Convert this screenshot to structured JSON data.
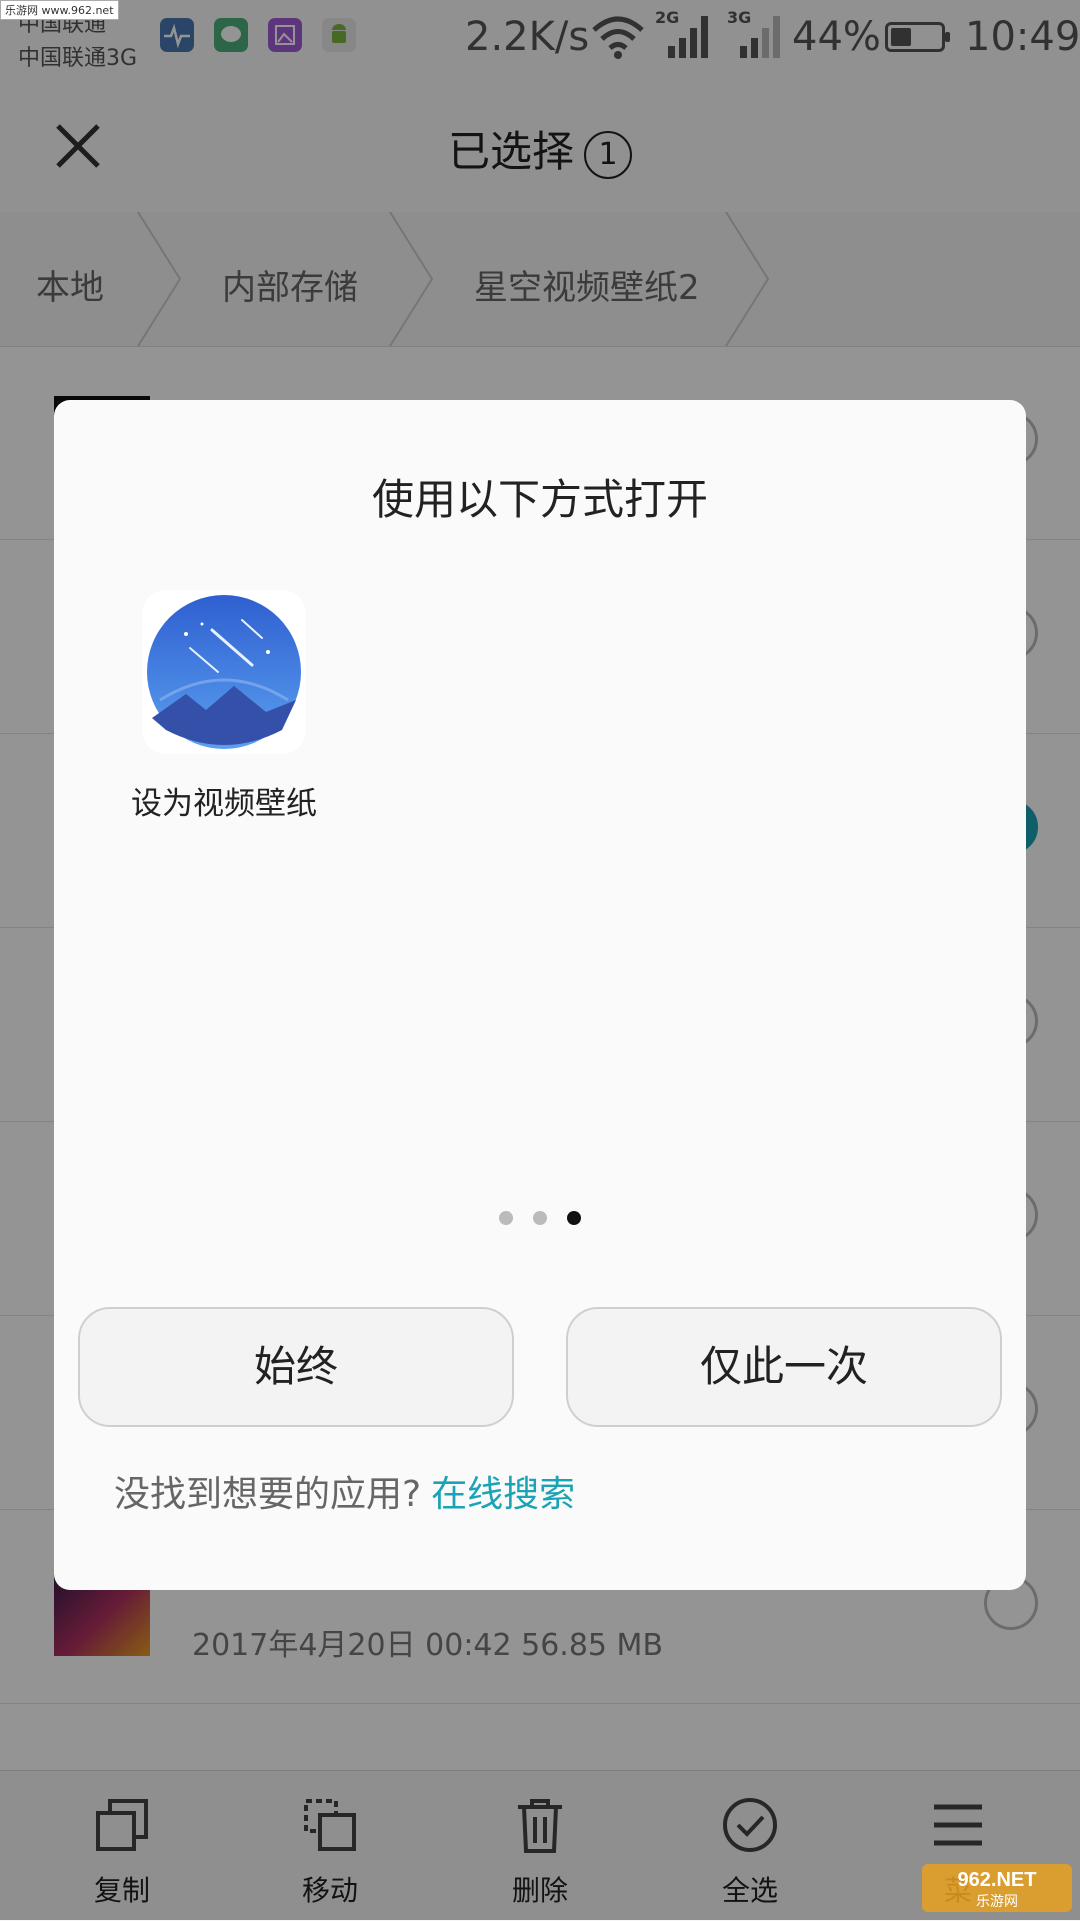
{
  "status_bar": {
    "carrier_top": "中国联通",
    "carrier_bottom": "中国联通3G",
    "speed": "2.2K/s",
    "sig1_label": "2G",
    "sig2_label": "3G",
    "battery": "44%",
    "time": "10:49",
    "notif_icons": [
      "health-app-icon",
      "message-app-icon",
      "gallery-app-icon",
      "android-app-icon"
    ]
  },
  "header": {
    "title": "已选择",
    "count": "1"
  },
  "breadcrumb": [
    "本地",
    "内部存储",
    "星空视频壁纸2"
  ],
  "list": {
    "rows": [
      {
        "title": "",
        "meta": "",
        "checked": false
      },
      {
        "title": "",
        "meta": "",
        "checked": false
      },
      {
        "title": "",
        "meta": "",
        "checked": true
      },
      {
        "title": "",
        "meta": "",
        "checked": false
      },
      {
        "title": "",
        "meta": "",
        "checked": false
      },
      {
        "title": "",
        "meta": "",
        "checked": false
      },
      {
        "title": "",
        "meta": "2017年4月20日 00:42 56.85 MB",
        "checked": false
      }
    ]
  },
  "toolbar": {
    "copy": "复制",
    "move": "移动",
    "delete": "删除",
    "select_all": "全选",
    "menu": "菜"
  },
  "dialog": {
    "title": "使用以下方式打开",
    "app_label": "设为视频壁纸",
    "pager_total": 3,
    "pager_active": 2,
    "always_button": "始终",
    "once_button": "仅此一次",
    "footer_text": "没找到想要的应用?",
    "footer_link": "在线搜索"
  },
  "watermark": {
    "top_left": "乐游网 www.962.net",
    "bottom_right": "962.NET 乐游网"
  },
  "colors": {
    "accent": "#1aa3b5",
    "overlay": "rgba(0,0,0,0.42)"
  }
}
